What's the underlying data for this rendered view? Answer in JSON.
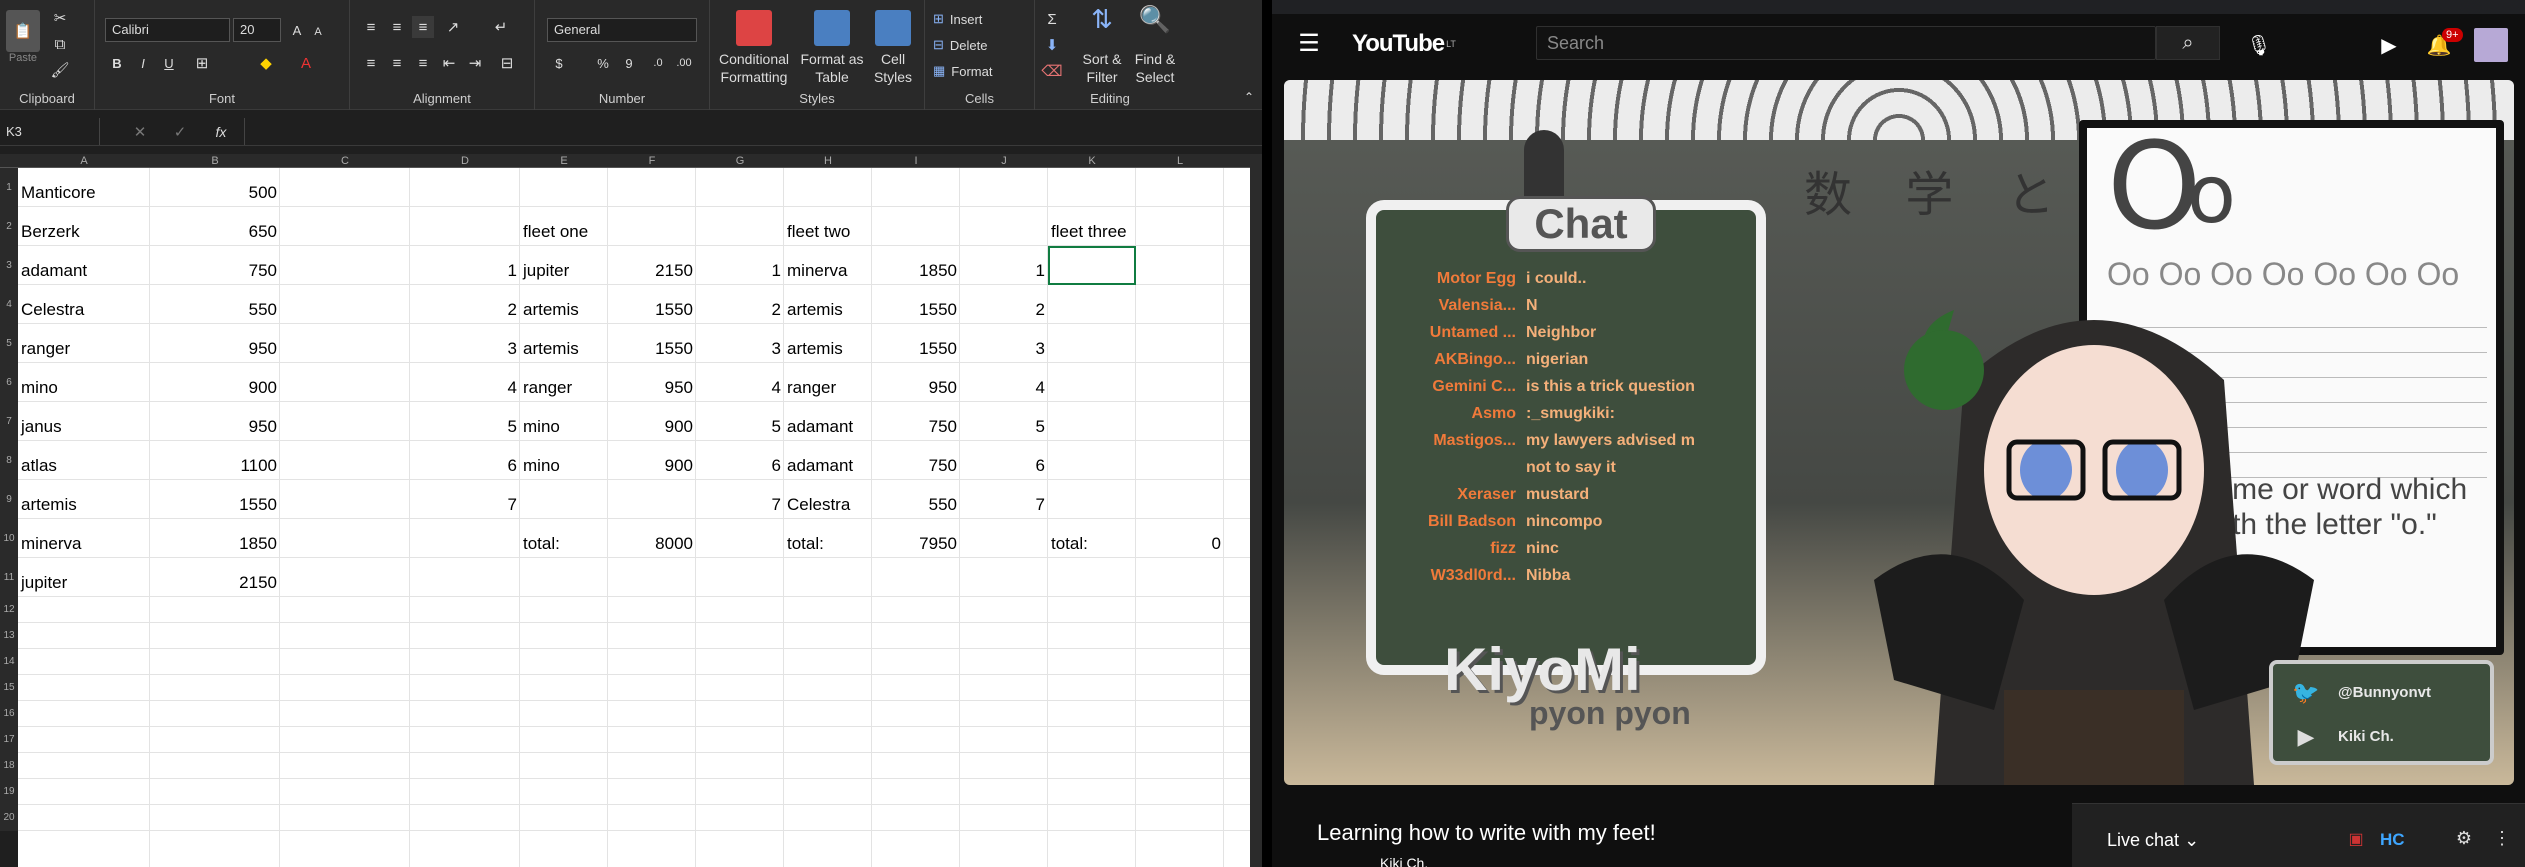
{
  "excel": {
    "ribbon": {
      "clipboard": {
        "label": "Clipboard",
        "paste": "Paste"
      },
      "font": {
        "label": "Font",
        "name": "Calibri",
        "size": "20",
        "bold": "B",
        "italic": "I",
        "underline": "U",
        "grow": "A",
        "shrink": "A"
      },
      "alignment": {
        "label": "Alignment"
      },
      "number": {
        "label": "Number",
        "format": "General",
        "currency": "$",
        "percent": "%",
        "comma": "9"
      },
      "styles": {
        "label": "Styles",
        "conditional": "Conditional Formatting",
        "format_table": "Format as Table",
        "cell_styles": "Cell Styles"
      },
      "cells": {
        "label": "Cells",
        "insert": "Insert",
        "delete": "Delete",
        "format": "Format"
      },
      "editing": {
        "label": "Editing",
        "sort": "Sort & Filter",
        "find": "Find & Select"
      }
    },
    "name_box": "K3",
    "fx": "fx",
    "columns": [
      "A",
      "B",
      "C",
      "D",
      "E",
      "F",
      "G",
      "H",
      "I",
      "J",
      "K",
      "L"
    ],
    "row_numbers": [
      "1",
      "2",
      "3",
      "4",
      "5",
      "6",
      "7",
      "8",
      "9",
      "10",
      "11",
      "12",
      "13",
      "14",
      "15",
      "16",
      "17",
      "18",
      "19",
      "20"
    ],
    "rows": [
      {
        "a": "Manticore",
        "b": "500",
        "d": "",
        "e": "",
        "f": "",
        "g": "",
        "h": "",
        "i": "",
        "j": "",
        "k": "",
        "l": ""
      },
      {
        "a": "Berzerk",
        "b": "650",
        "d": "",
        "e": "fleet one",
        "f": "",
        "g": "",
        "h": "fleet two",
        "i": "",
        "j": "",
        "k": "fleet three",
        "l": ""
      },
      {
        "a": "adamant",
        "b": "750",
        "d": "1",
        "e": "jupiter",
        "f": "2150",
        "g": "1",
        "h": "minerva",
        "i": "1850",
        "j": "1",
        "k": "",
        "l": ""
      },
      {
        "a": "Celestra",
        "b": "550",
        "d": "2",
        "e": "artemis",
        "f": "1550",
        "g": "2",
        "h": "artemis",
        "i": "1550",
        "j": "2",
        "k": "",
        "l": ""
      },
      {
        "a": "ranger",
        "b": "950",
        "d": "3",
        "e": "artemis",
        "f": "1550",
        "g": "3",
        "h": "artemis",
        "i": "1550",
        "j": "3",
        "k": "",
        "l": ""
      },
      {
        "a": "mino",
        "b": "900",
        "d": "4",
        "e": "ranger",
        "f": "950",
        "g": "4",
        "h": "ranger",
        "i": "950",
        "j": "4",
        "k": "",
        "l": ""
      },
      {
        "a": "janus",
        "b": "950",
        "d": "5",
        "e": "mino",
        "f": "900",
        "g": "5",
        "h": "adamant",
        "i": "750",
        "j": "5",
        "k": "",
        "l": ""
      },
      {
        "a": "atlas",
        "b": "1100",
        "d": "6",
        "e": "mino",
        "f": "900",
        "g": "6",
        "h": "adamant",
        "i": "750",
        "j": "6",
        "k": "",
        "l": ""
      },
      {
        "a": "artemis",
        "b": "1550",
        "d": "7",
        "e": "",
        "f": "",
        "g": "7",
        "h": "Celestra",
        "i": "550",
        "j": "7",
        "k": "",
        "l": ""
      },
      {
        "a": "minerva",
        "b": "1850",
        "d": "",
        "e": "total:",
        "f": "8000",
        "g": "",
        "h": "total:",
        "i": "7950",
        "j": "",
        "k": "total:",
        "l": "0"
      },
      {
        "a": "jupiter",
        "b": "2150",
        "d": "",
        "e": "",
        "f": "",
        "g": "",
        "h": "",
        "i": "",
        "j": "",
        "k": "",
        "l": ""
      }
    ]
  },
  "youtube": {
    "logo": "YouTube",
    "logo_sup": "LT",
    "search_placeholder": "Search",
    "notif_count": "9+",
    "chat_title": "Chat",
    "chat": [
      {
        "user": "Motor Egg",
        "msg": "i could.."
      },
      {
        "user": "Valensia...",
        "msg": "N"
      },
      {
        "user": "Untamed ...",
        "msg": "Neighbor"
      },
      {
        "user": "AKBingo...",
        "msg": "nigerian"
      },
      {
        "user": "Gemini C...",
        "msg": "is this a trick question"
      },
      {
        "user": "Asmo",
        "msg": ":_smugkiki:"
      },
      {
        "user": "Mastigos...",
        "msg": "my lawyers advised m"
      },
      {
        "user": "",
        "msg": "not to say it"
      },
      {
        "user": "Xeraser",
        "msg": "mustard"
      },
      {
        "user": "Bill Badson",
        "msg": "nincompo"
      },
      {
        "user": "fizz",
        "msg": "ninc"
      },
      {
        "user": "W33dl0rd...",
        "msg": "Nibba"
      }
    ],
    "board_line1": "Find a name or word which",
    "board_line2": "begins with the letter \"o.\"",
    "board_letters": "Oo  Oo  Oo  Oo  Oo  Oo  Oo",
    "board_kanji": "数 学 と 物",
    "logo_kiyo": "KiyoMi",
    "logo_pyon": "pyon pyon",
    "twitter": "@Bunnyonvt",
    "yt_channel": "Kiki Ch.",
    "video_title": "Learning how to write with my feet!",
    "channel_name": "Kiki Ch.",
    "live_chat": "Live chat",
    "hc": "HC"
  }
}
